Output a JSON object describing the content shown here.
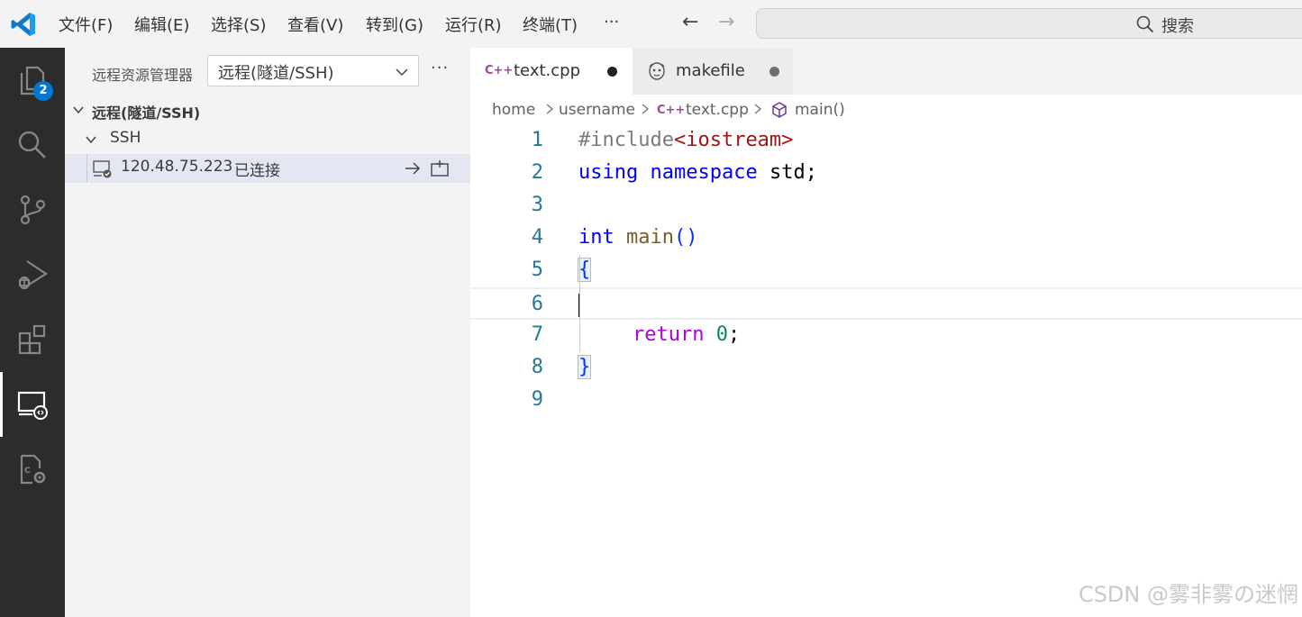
{
  "menu": [
    "文件(F)",
    "编辑(E)",
    "选择(S)",
    "查看(V)",
    "转到(G)",
    "运行(R)",
    "终端(T)"
  ],
  "menu_more": "···",
  "nav": {
    "back": "←",
    "forward": "→"
  },
  "search": {
    "label": "搜索"
  },
  "activity": {
    "explorer_badge": "2"
  },
  "sidebar": {
    "title": "远程资源管理器",
    "select_value": "远程(隧道/SSH)",
    "more": "···",
    "tree": {
      "section": "远程(隧道/SSH)",
      "group": "SSH",
      "host": "120.48.75.223",
      "host_status": "已连接"
    }
  },
  "tabs": [
    {
      "label": "text.cpp",
      "icon": "C++"
    },
    {
      "label": "makefile"
    }
  ],
  "breadcrumb": [
    "home",
    "username",
    "text.cpp",
    "main()"
  ],
  "code": {
    "line_numbers": [
      "1",
      "2",
      "3",
      "4",
      "5",
      "6",
      "7",
      "8",
      "9"
    ],
    "l1_a": "#include",
    "l1_b": "<iostream>",
    "l2_a": "using",
    "l2_b": "namespace",
    "l2_c": "std;",
    "l4_a": "int",
    "l4_b": "main",
    "l4_c": "()",
    "l5": "{",
    "l7_a": "return",
    "l7_b": "0",
    "l7_c": ";",
    "l8": "}"
  },
  "watermark": "CSDN @雾非雾の迷惘",
  "colors": {
    "keyword_blue": "#0000ff",
    "include_gray": "#7b7b7b",
    "string_red": "#a31515",
    "function_brown": "#795e26",
    "control_purple": "#af00db",
    "number_green": "#098658",
    "line_number": "#237893",
    "accent": "#0078d4"
  }
}
